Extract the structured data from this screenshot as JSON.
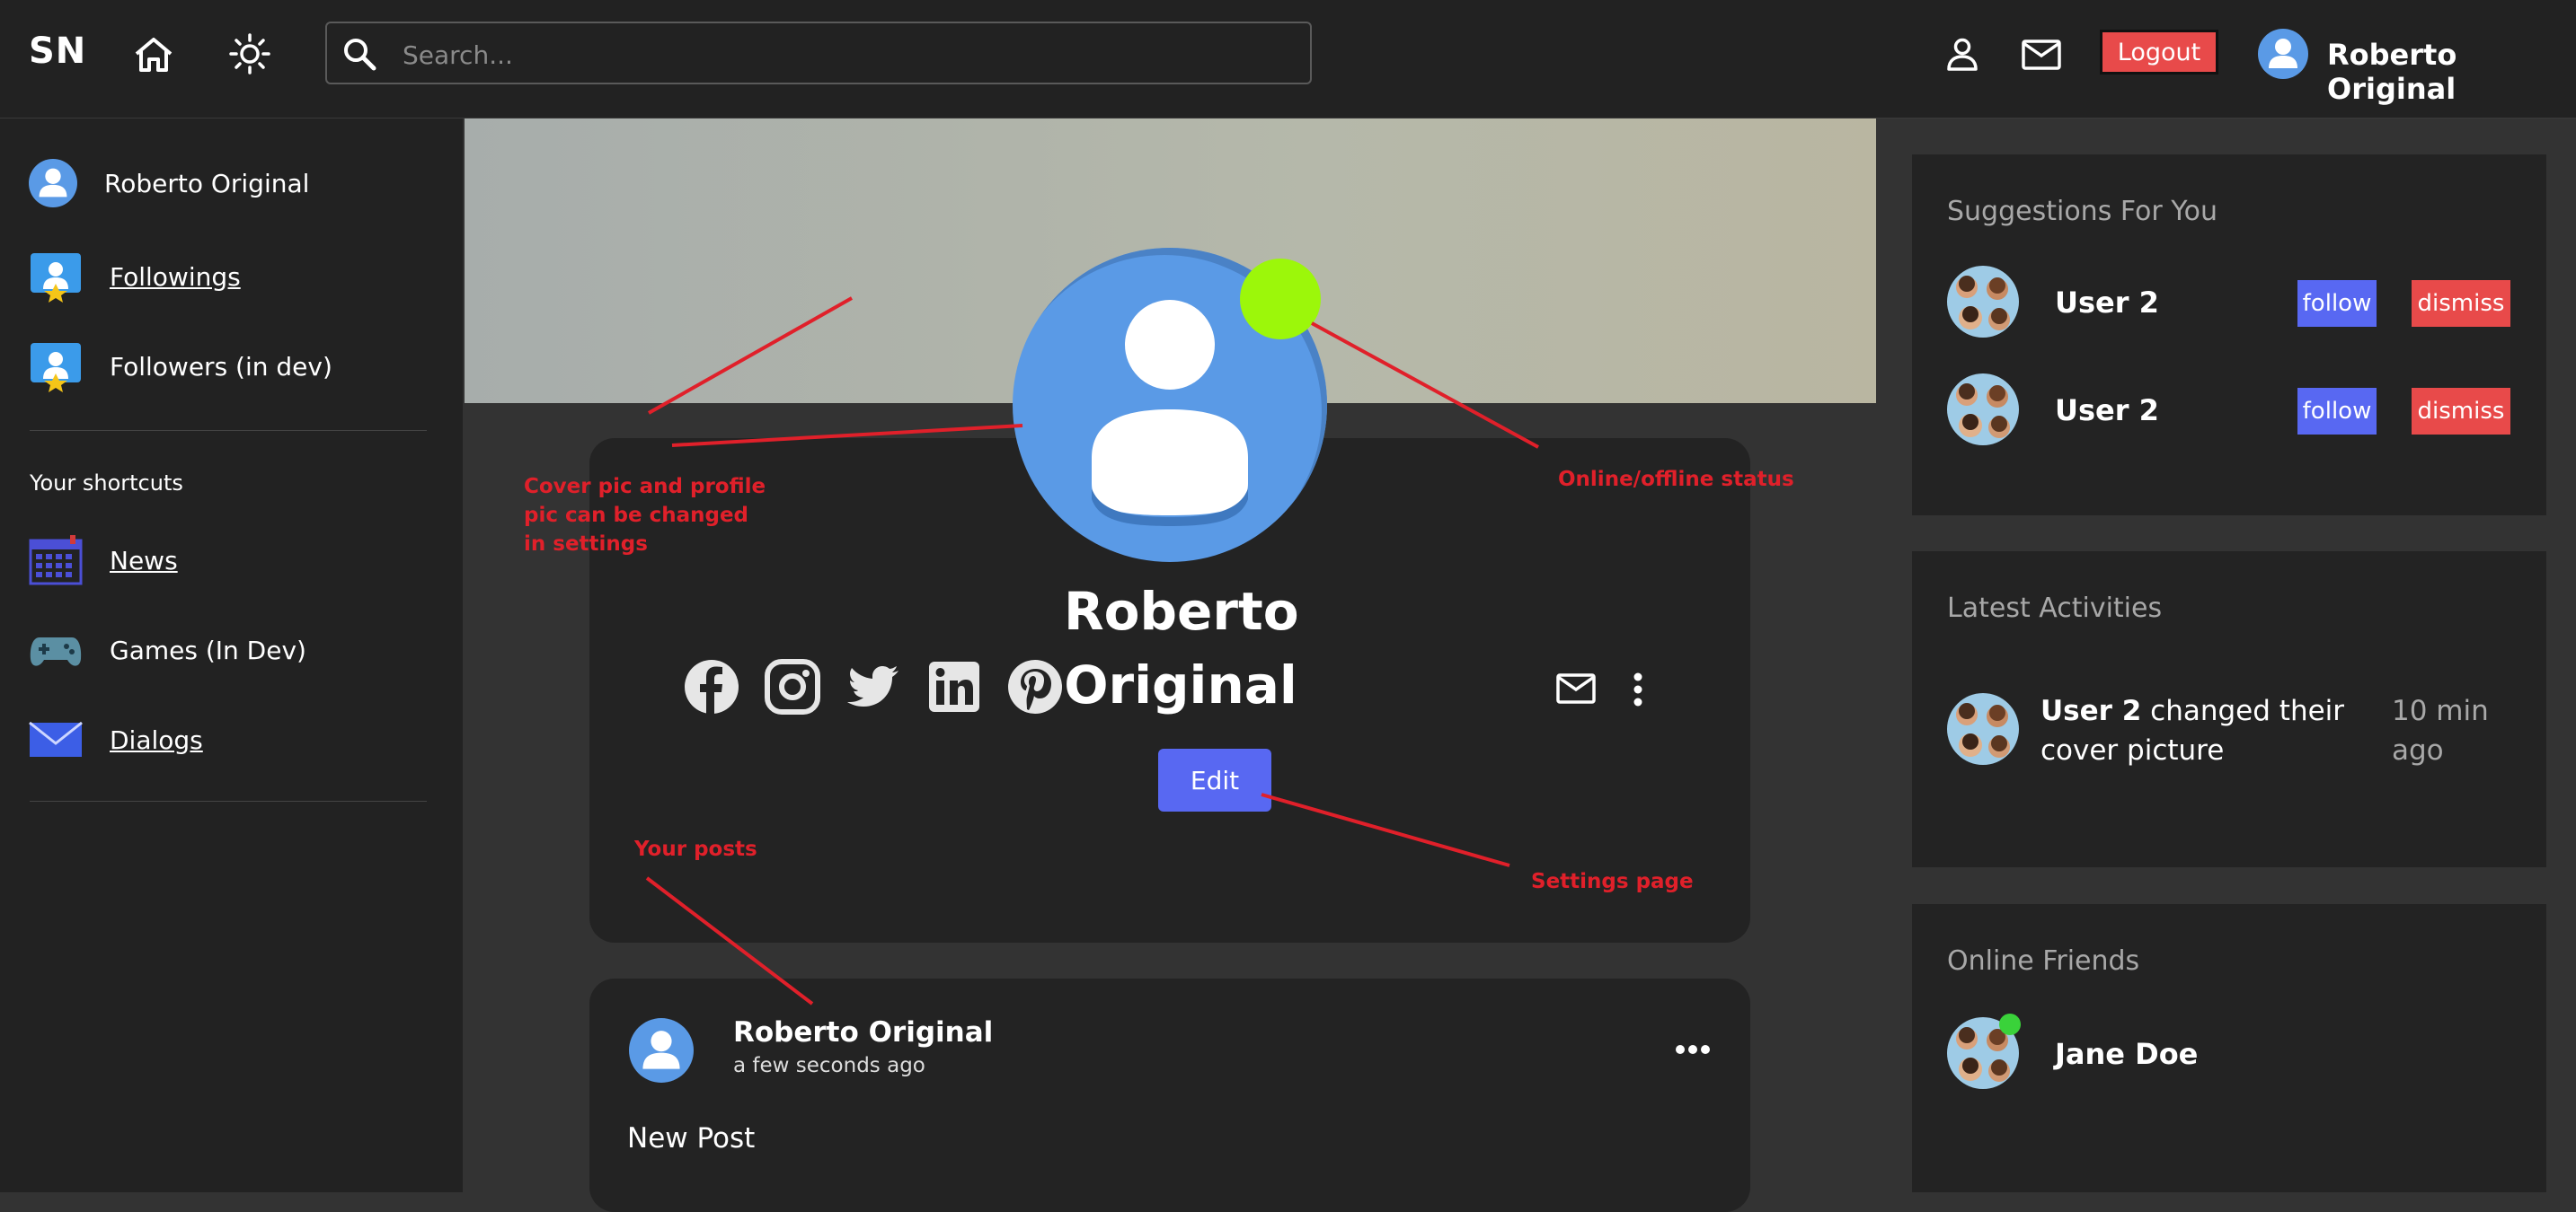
{
  "header": {
    "logo": "SN",
    "search_placeholder": "Search...",
    "logout_label": "Logout",
    "user_name": "Roberto Original"
  },
  "sidebar": {
    "profile_name": "Roberto Original",
    "items": [
      {
        "label": "Followings",
        "icon": "followings-icon"
      },
      {
        "label": "Followers (in dev)",
        "icon": "followers-icon"
      }
    ],
    "shortcuts_title": "Your shortcuts",
    "shortcuts": [
      {
        "label": "News",
        "icon": "calendar-icon"
      },
      {
        "label": "Games (In Dev)",
        "icon": "gamepad-icon"
      },
      {
        "label": "Dialogs",
        "icon": "envelope-icon"
      }
    ]
  },
  "profile": {
    "name_line1": "Roberto",
    "name_line2": "Original",
    "edit_label": "Edit",
    "status": "online",
    "status_color": "#9cf70a",
    "socials": [
      "facebook-icon",
      "instagram-icon",
      "twitter-icon",
      "linkedin-icon",
      "pinterest-icon"
    ]
  },
  "post": {
    "author": "Roberto Original",
    "time": "a few seconds ago",
    "text": "New Post"
  },
  "suggestions": {
    "title": "Suggestions For You",
    "items": [
      {
        "name": "User 2",
        "follow_label": "follow",
        "dismiss_label": "dismiss"
      },
      {
        "name": "User 2",
        "follow_label": "follow",
        "dismiss_label": "dismiss"
      }
    ]
  },
  "activities": {
    "title": "Latest Activities",
    "items": [
      {
        "user": "User 2",
        "action": "changed their cover picture",
        "time": "10 min ago"
      }
    ]
  },
  "online_friends": {
    "title": "Online Friends",
    "items": [
      {
        "name": "Jane Doe",
        "online": true
      }
    ]
  },
  "annotations": {
    "cover_pic": "Cover pic and profile pic can be changed in settings",
    "online_status": "Online/offline status",
    "your_posts": "Your posts",
    "settings_page": "Settings page"
  },
  "colors": {
    "accent_blue": "#5868f2",
    "danger_red": "#e84a4a",
    "avatar_blue": "#5a9ae6",
    "annotation_red": "#e0202a"
  }
}
